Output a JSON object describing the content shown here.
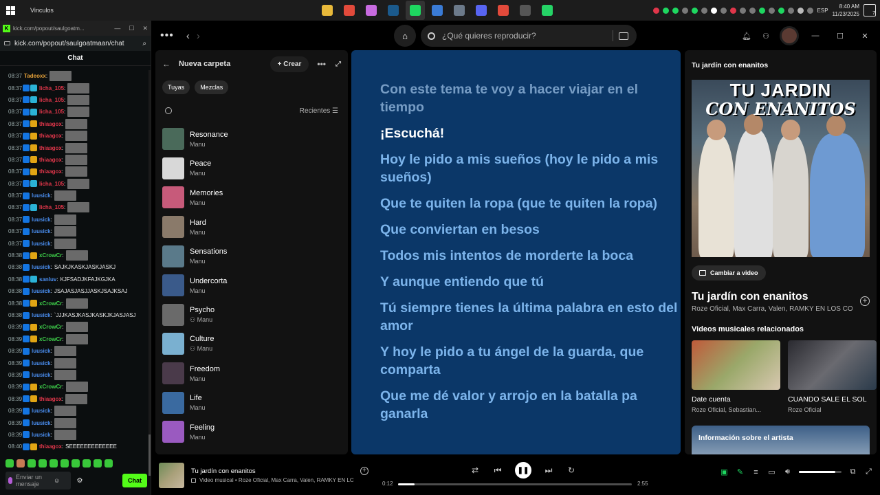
{
  "taskbar": {
    "window_title": "Vinculos",
    "apps": [
      {
        "name": "file-explorer",
        "color": "#e8b93a"
      },
      {
        "name": "chrome",
        "color": "#e24a3b"
      },
      {
        "name": "copilot",
        "color": "#c86be0"
      },
      {
        "name": "steam",
        "color": "#1b5a8c"
      },
      {
        "name": "spotify",
        "color": "#1ed760"
      },
      {
        "name": "ms-store",
        "color": "#3a7bd5"
      },
      {
        "name": "monitor",
        "color": "#6c7a8a"
      },
      {
        "name": "discord",
        "color": "#5865f2"
      },
      {
        "name": "chrome-profile",
        "color": "#e24a3b"
      },
      {
        "name": "obs",
        "color": "#555555"
      },
      {
        "name": "whatsapp",
        "color": "#25d366"
      }
    ],
    "lang": "ESP",
    "time": "8:40 AM",
    "date": "11/23/2025",
    "notif_count": "7"
  },
  "kick": {
    "title": "kick.com/popout/saulgoatm...",
    "url": "kick.com/popout/saulgoatmaan/chat",
    "chat_label": "Chat",
    "input_placeholder": "Enviar un mensaje",
    "send_label": "Chat",
    "messages": [
      {
        "t": "08:37",
        "u": "Tadeoxx",
        "c": "#e8a33a",
        "msg": "",
        "b": [],
        "e": true
      },
      {
        "t": "08:37",
        "u": "licha_105",
        "c": "#e0364a",
        "msg": "",
        "b": [
          "verif",
          "sub"
        ],
        "e": true
      },
      {
        "t": "08:37",
        "u": "licha_105",
        "c": "#e0364a",
        "msg": "",
        "b": [
          "verif",
          "sub"
        ],
        "e": true
      },
      {
        "t": "08:37",
        "u": "licha_105",
        "c": "#e0364a",
        "msg": "",
        "b": [
          "verif",
          "sub"
        ],
        "e": true
      },
      {
        "t": "08:37",
        "u": "thiaagox",
        "c": "#e0364a",
        "msg": "",
        "b": [
          "verif",
          "crown"
        ],
        "e": true
      },
      {
        "t": "08:37",
        "u": "thiaagox",
        "c": "#e0364a",
        "msg": "",
        "b": [
          "verif",
          "crown"
        ],
        "e": true
      },
      {
        "t": "08:37",
        "u": "thiaagox",
        "c": "#e0364a",
        "msg": "",
        "b": [
          "verif",
          "crown"
        ],
        "e": true
      },
      {
        "t": "08:37",
        "u": "thiaagox",
        "c": "#e0364a",
        "msg": "",
        "b": [
          "verif",
          "crown"
        ],
        "e": true
      },
      {
        "t": "08:37",
        "u": "thiaagox",
        "c": "#e0364a",
        "msg": "",
        "b": [
          "verif",
          "crown"
        ],
        "e": true
      },
      {
        "t": "08:37",
        "u": "licha_105",
        "c": "#e0364a",
        "msg": "",
        "b": [
          "verif",
          "sub"
        ],
        "e": true
      },
      {
        "t": "08:37",
        "u": "luusick",
        "c": "#4a8ef0",
        "msg": "",
        "b": [
          "verif"
        ],
        "e": true
      },
      {
        "t": "08:37",
        "u": "licha_105",
        "c": "#e0364a",
        "msg": "",
        "b": [
          "verif",
          "sub"
        ],
        "e": true
      },
      {
        "t": "08:37",
        "u": "luusick",
        "c": "#4a8ef0",
        "msg": "",
        "b": [
          "verif"
        ],
        "e": true
      },
      {
        "t": "08:37",
        "u": "luusick",
        "c": "#4a8ef0",
        "msg": "",
        "b": [
          "verif"
        ],
        "e": true
      },
      {
        "t": "08:37",
        "u": "luusick",
        "c": "#4a8ef0",
        "msg": "",
        "b": [
          "verif"
        ],
        "e": true
      },
      {
        "t": "08:38",
        "u": "xCrowCr",
        "c": "#3ecf4a",
        "msg": "",
        "b": [
          "verif",
          "crown"
        ],
        "e": true
      },
      {
        "t": "08:38",
        "u": "luusick",
        "c": "#4a8ef0",
        "msg": "SAJKJKASKJASKJASKJ",
        "b": [
          "verif"
        ],
        "e": false
      },
      {
        "t": "08:38",
        "u": "sanluv",
        "c": "#4a8ef0",
        "msg": "KJFSADJKFAJKGJKA",
        "b": [
          "verif",
          "sub"
        ],
        "e": false
      },
      {
        "t": "08:38",
        "u": "luusick",
        "c": "#4a8ef0",
        "msg": "JSAJASJASJJASKJSAJKSAJ",
        "b": [
          "verif"
        ],
        "e": false
      },
      {
        "t": "08:38",
        "u": "xCrowCr",
        "c": "#3ecf4a",
        "msg": "",
        "b": [
          "verif",
          "crown"
        ],
        "e": true
      },
      {
        "t": "08:38",
        "u": "luusick",
        "c": "#4a8ef0",
        "msg": "`JJJKASJKASJKASKJKJASJASJ",
        "b": [
          "verif"
        ],
        "e": false
      },
      {
        "t": "08:39",
        "u": "xCrowCr",
        "c": "#3ecf4a",
        "msg": "",
        "b": [
          "verif",
          "crown"
        ],
        "e": true
      },
      {
        "t": "08:39",
        "u": "xCrowCr",
        "c": "#3ecf4a",
        "msg": "",
        "b": [
          "verif",
          "crown"
        ],
        "e": true
      },
      {
        "t": "08:39",
        "u": "luusick",
        "c": "#4a8ef0",
        "msg": "",
        "b": [
          "verif"
        ],
        "e": true
      },
      {
        "t": "08:39",
        "u": "luusick",
        "c": "#4a8ef0",
        "msg": "",
        "b": [
          "verif"
        ],
        "e": true
      },
      {
        "t": "08:39",
        "u": "luusick",
        "c": "#4a8ef0",
        "msg": "",
        "b": [
          "verif"
        ],
        "e": true
      },
      {
        "t": "08:39",
        "u": "xCrowCr",
        "c": "#3ecf4a",
        "msg": "",
        "b": [
          "verif",
          "crown"
        ],
        "e": true
      },
      {
        "t": "08:39",
        "u": "thiaagox",
        "c": "#e0364a",
        "msg": "",
        "b": [
          "verif",
          "crown"
        ],
        "e": true
      },
      {
        "t": "08:39",
        "u": "luusick",
        "c": "#4a8ef0",
        "msg": "",
        "b": [
          "verif"
        ],
        "e": true
      },
      {
        "t": "08:39",
        "u": "luusick",
        "c": "#4a8ef0",
        "msg": "",
        "b": [
          "verif"
        ],
        "e": true
      },
      {
        "t": "08:39",
        "u": "luusick",
        "c": "#4a8ef0",
        "msg": "",
        "b": [
          "verif"
        ],
        "e": true
      },
      {
        "t": "08:40",
        "u": "thiaagox",
        "c": "#e0364a",
        "msg": "SEEEEEEEEEEEEE",
        "b": [
          "verif",
          "crown"
        ],
        "e": false
      }
    ]
  },
  "spotify": {
    "search_placeholder": "¿Qué quieres reproducir?",
    "library": {
      "title": "Nueva carpeta",
      "create": "Crear",
      "chips": [
        "Tuyas",
        "Mezclas"
      ],
      "sort": "Recientes",
      "items": [
        {
          "name": "Resonance",
          "owner": "Manu",
          "color": "#4a6a5a"
        },
        {
          "name": "Peace",
          "owner": "Manu",
          "color": "#d8d8d8"
        },
        {
          "name": "Memories",
          "owner": "Manu",
          "color": "#c75a7a"
        },
        {
          "name": "Hard",
          "owner": "Manu",
          "color": "#8a7a6a"
        },
        {
          "name": "Sensations",
          "owner": "Manu",
          "color": "#5a7a8a"
        },
        {
          "name": "Undercorta",
          "owner": "Manu",
          "color": "#3a5a8a"
        },
        {
          "name": "Psycho",
          "owner": "Manu",
          "color": "#6a6a6a",
          "collab": true
        },
        {
          "name": "Culture",
          "owner": "Manu",
          "color": "#7ab0d0",
          "collab": true
        },
        {
          "name": "Freedom",
          "owner": "Manu",
          "color": "#4a3a4a"
        },
        {
          "name": "Life",
          "owner": "Manu",
          "color": "#3a6aa0"
        },
        {
          "name": "Feeling",
          "owner": "Manu",
          "color": "#9a5ac0"
        }
      ]
    },
    "lyrics": [
      {
        "text": "Con este tema te voy a hacer viajar en el tiempo",
        "state": "past"
      },
      {
        "text": "¡Escuchá!",
        "state": "now"
      },
      {
        "text": "Hoy le pido a mis sueños (hoy le pido a mis sueños)",
        "state": "next"
      },
      {
        "text": "Que te quiten la ropa (que te quiten la ropa)",
        "state": "next"
      },
      {
        "text": "Que conviertan en besos",
        "state": "next"
      },
      {
        "text": "Todos mis intentos de morderte la boca",
        "state": "next"
      },
      {
        "text": "Y aunque entiendo que tú",
        "state": "next"
      },
      {
        "text": "Tú siempre tienes la última palabra en esto del amor",
        "state": "next"
      },
      {
        "text": "Y hoy le pido a tu ángel de la guarda, que comparta",
        "state": "next"
      },
      {
        "text": "Que me dé valor y arrojo en la batalla pa ganarla",
        "state": "next"
      }
    ],
    "right_panel": {
      "header": "Tu jardín con enanitos",
      "cover_title": "TU JARDIN",
      "cover_sub": "CON ENANITOS",
      "switch_video": "Cambiar a video",
      "song_title": "Tu jardín con enanitos",
      "artists": "Roze Oficial, Max Carra, Valen, RAMKY EN LOS CO",
      "related_header": "Videos musicales relacionados",
      "related": [
        {
          "title": "Date cuenta",
          "artists": "Roze Oficial, Sebastian..."
        },
        {
          "title": "CUANDO SALE EL SOL",
          "artists": "Roze Oficial"
        }
      ],
      "artist_info": "Información sobre el artista"
    },
    "player": {
      "title": "Tu jardín con enanitos",
      "subtitle": "Video musical • Roze Oficial, Max Carra, Valen, RAMKY EN LO",
      "elapsed": "0:12",
      "duration": "2:55",
      "progress": 0.07,
      "volume": 0.85
    }
  }
}
